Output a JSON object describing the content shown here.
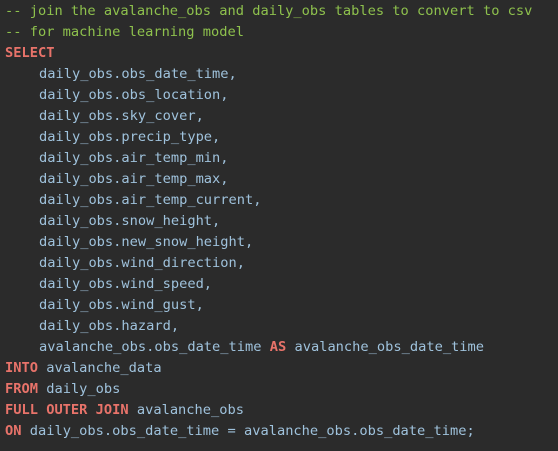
{
  "code": {
    "comment_1": "-- join the avalanche_obs and daily_obs tables to convert to csv",
    "comment_2": "-- for machine learning model",
    "select_kw": "SELECT",
    "columns": [
      "daily_obs.obs_date_time,",
      "daily_obs.obs_location,",
      "daily_obs.sky_cover,",
      "daily_obs.precip_type,",
      "daily_obs.air_temp_min,",
      "daily_obs.air_temp_max,",
      "daily_obs.air_temp_current,",
      "daily_obs.snow_height,",
      "daily_obs.new_snow_height,",
      "daily_obs.wind_direction,",
      "daily_obs.wind_speed,",
      "daily_obs.wind_gust,",
      "daily_obs.hazard,"
    ],
    "alias_col": "avalanche_obs.obs_date_time",
    "as_kw": "AS",
    "alias_name": "avalanche_obs_date_time",
    "into_kw": "INTO",
    "into_table": "avalanche_data",
    "from_kw": "FROM",
    "from_table": "daily_obs",
    "join_kw": "FULL OUTER JOIN",
    "join_table": "avalanche_obs",
    "on_kw": "ON",
    "on_clause": "daily_obs.obs_date_time = avalanche_obs.obs_date_time;"
  },
  "colors": {
    "background": "#2b2b2b",
    "comment": "#8ec14d",
    "keyword": "#e8736a",
    "identifier": "#9fc2dc"
  }
}
